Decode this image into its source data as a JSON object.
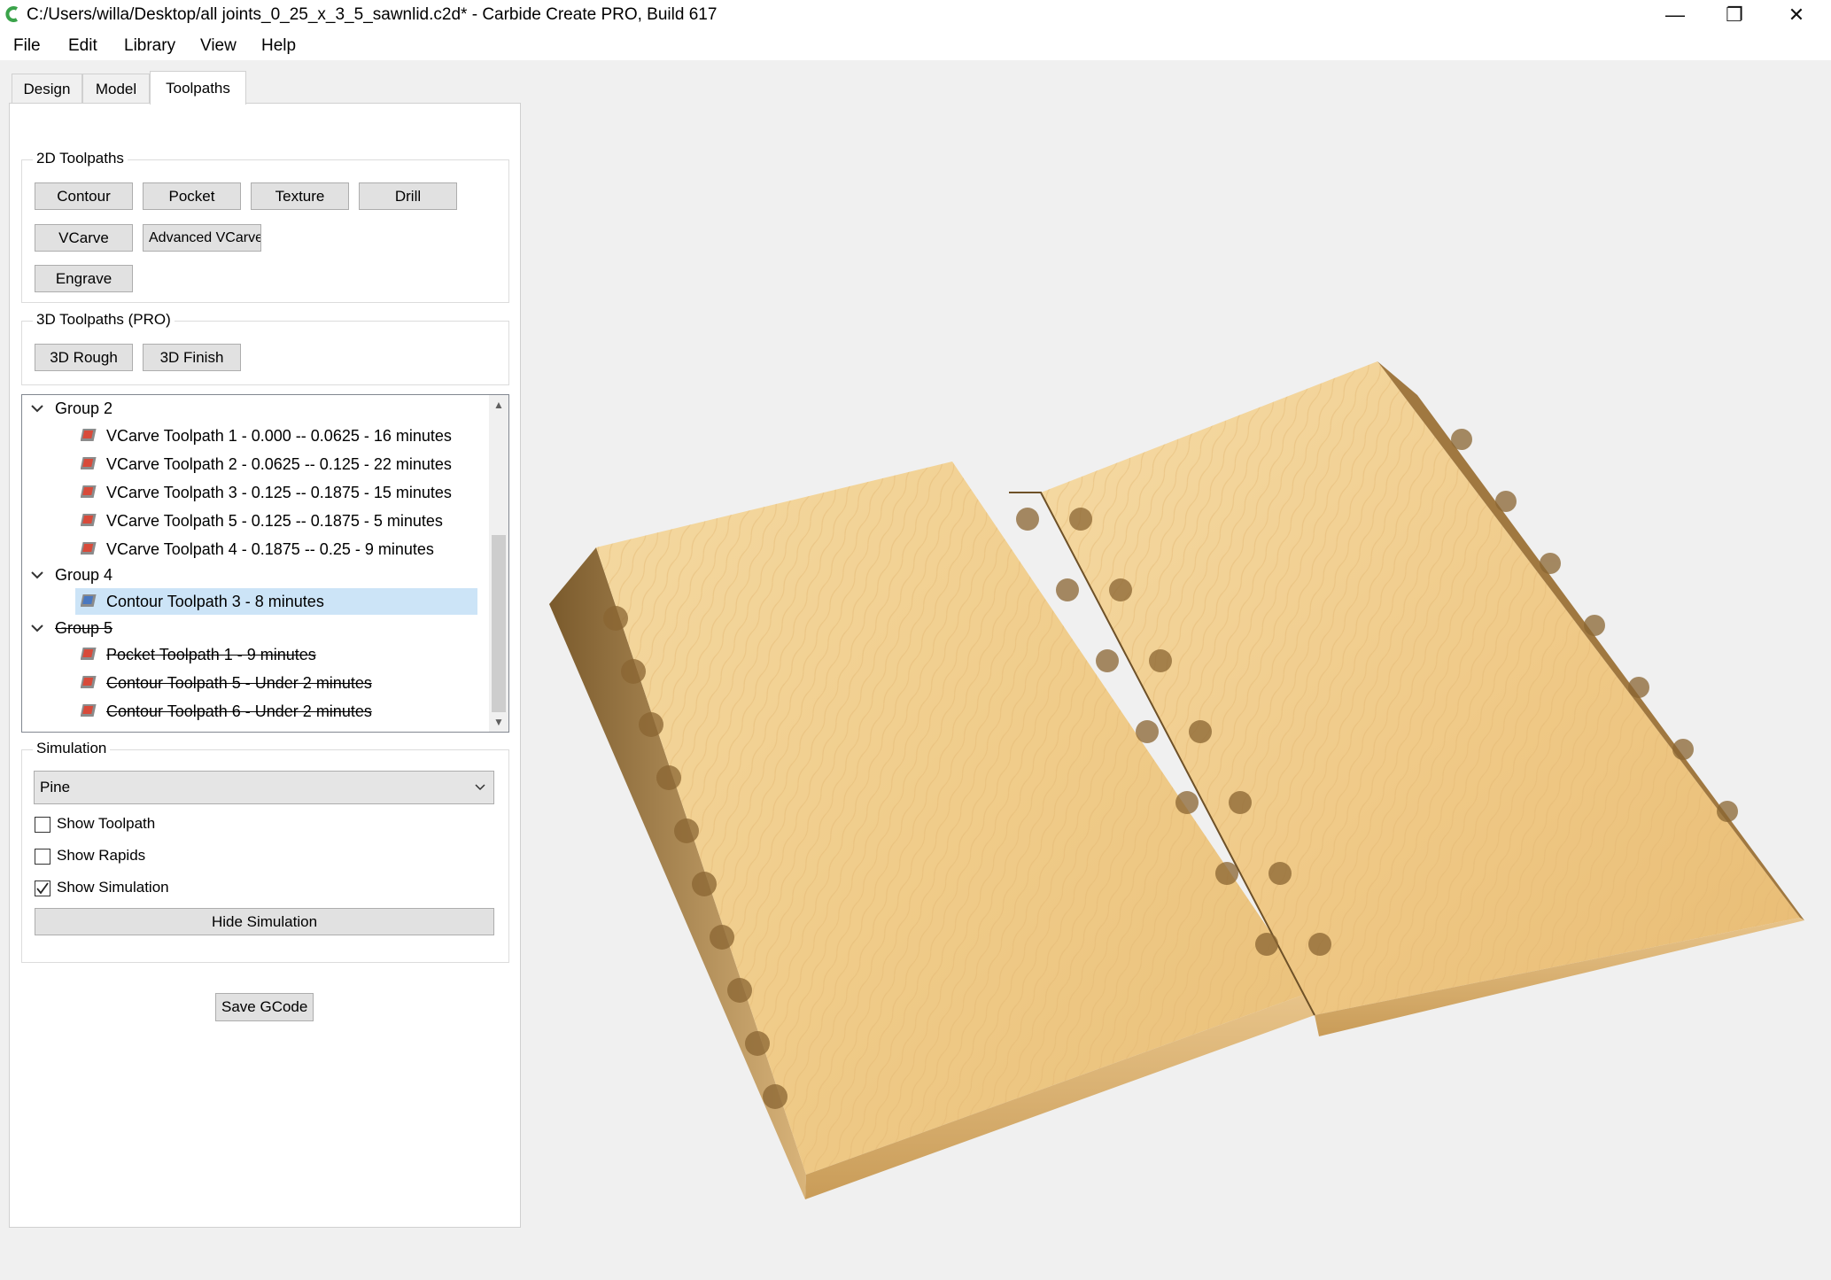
{
  "window": {
    "title": "C:/Users/willa/Desktop/all joints_0_25_x_3_5_sawnlid.c2d* - Carbide Create PRO, Build 617",
    "controls": {
      "minimize": "—",
      "maximize": "❐",
      "close": "✕"
    }
  },
  "menu": {
    "file": "File",
    "edit": "Edit",
    "library": "Library",
    "view": "View",
    "help": "Help"
  },
  "tabs": {
    "design": "Design",
    "model": "Model",
    "toolpaths": "Toolpaths"
  },
  "toolpaths_2d": {
    "title": "2D Toolpaths",
    "contour": "Contour",
    "pocket": "Pocket",
    "texture": "Texture",
    "drill": "Drill",
    "vcarve": "VCarve",
    "advanced_vcarve": "Advanced VCarve",
    "engrave": "Engrave"
  },
  "toolpaths_3d": {
    "title": "3D Toolpaths (PRO)",
    "rough": "3D Rough",
    "finish": "3D Finish"
  },
  "tree": {
    "group2": {
      "label": "Group 2",
      "items": [
        "VCarve Toolpath 1 - 0.000 -- 0.0625 - 16 minutes",
        "VCarve Toolpath 2 - 0.0625 -- 0.125 - 22 minutes",
        "VCarve Toolpath 3 - 0.125 -- 0.1875 - 15 minutes",
        "VCarve Toolpath 5 - 0.125 -- 0.1875 - 5 minutes",
        "VCarve Toolpath 4 - 0.1875 -- 0.25 - 9 minutes"
      ]
    },
    "group4": {
      "label": "Group 4",
      "items": [
        "Contour Toolpath 3 - 8 minutes"
      ]
    },
    "group5": {
      "label": "Group 5",
      "items": [
        "Pocket Toolpath 1 - 9 minutes",
        "Contour Toolpath 5 - Under 2 minutes",
        "Contour Toolpath 6 - Under 2 minutes"
      ]
    }
  },
  "simulation": {
    "title": "Simulation",
    "material": "Pine",
    "show_toolpath": "Show Toolpath",
    "show_rapids": "Show Rapids",
    "show_simulation": "Show Simulation",
    "hide_button": "Hide Simulation"
  },
  "save_gcode": "Save GCode",
  "colors": {
    "accent": "#0078d7",
    "selection": "#cce4f7",
    "wood_light": "#f0cf92",
    "wood_dark": "#b88a4a"
  }
}
